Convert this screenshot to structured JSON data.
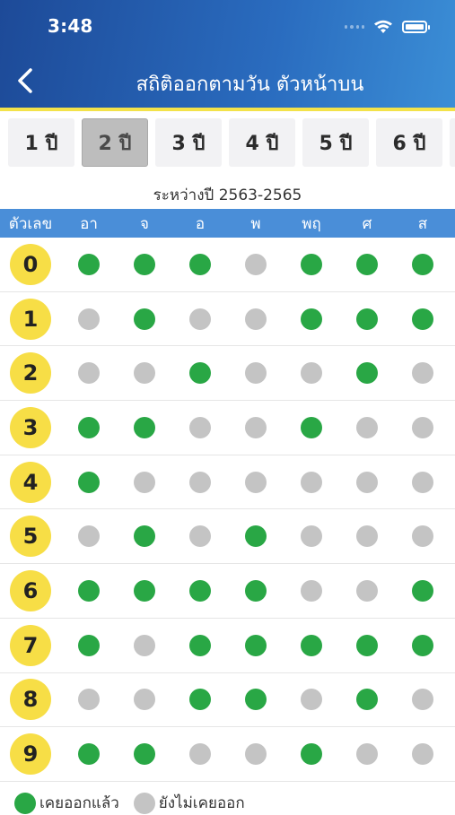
{
  "status": {
    "time": "3:48"
  },
  "header": {
    "title": "สถิติออกตามวัน ตัวหน้าบน"
  },
  "tabs": [
    "1 ปี",
    "2 ปี",
    "3 ปี",
    "4 ปี",
    "5 ปี",
    "6 ปี"
  ],
  "active_tab": 1,
  "range_text": "ระหว่างปี 2563-2565",
  "table": {
    "number_header": "ตัวเลข",
    "days": [
      "อา",
      "จ",
      "อ",
      "พ",
      "พฤ",
      "ศ",
      "ส"
    ],
    "rows": [
      {
        "number": "0",
        "marks": [
          1,
          1,
          1,
          0,
          1,
          1,
          1
        ]
      },
      {
        "number": "1",
        "marks": [
          0,
          1,
          0,
          0,
          1,
          1,
          1
        ]
      },
      {
        "number": "2",
        "marks": [
          0,
          0,
          1,
          0,
          0,
          1,
          0
        ]
      },
      {
        "number": "3",
        "marks": [
          1,
          1,
          0,
          0,
          1,
          0,
          0
        ]
      },
      {
        "number": "4",
        "marks": [
          1,
          0,
          0,
          0,
          0,
          0,
          0
        ]
      },
      {
        "number": "5",
        "marks": [
          0,
          1,
          0,
          1,
          0,
          0,
          0
        ]
      },
      {
        "number": "6",
        "marks": [
          1,
          1,
          1,
          1,
          0,
          0,
          1
        ]
      },
      {
        "number": "7",
        "marks": [
          1,
          0,
          1,
          1,
          1,
          1,
          1
        ]
      },
      {
        "number": "8",
        "marks": [
          0,
          0,
          1,
          1,
          0,
          1,
          0
        ]
      },
      {
        "number": "9",
        "marks": [
          1,
          1,
          0,
          0,
          1,
          0,
          0
        ]
      }
    ]
  },
  "legend": {
    "on_label": "เคยออกแล้ว",
    "off_label": "ยังไม่เคยออก"
  },
  "colors": {
    "on": "#29a745",
    "off": "#c4c4c4",
    "number_bg": "#f7de46",
    "header_bar": "#4a8ed8"
  }
}
